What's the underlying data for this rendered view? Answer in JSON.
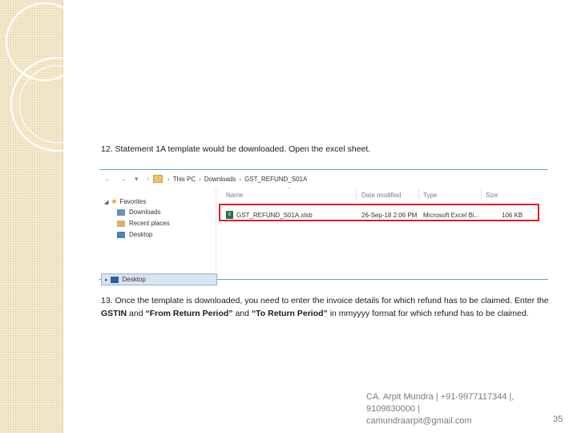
{
  "steps": {
    "step12": "12. Statement 1A template would be downloaded. Open the excel sheet.",
    "step13_part1": "13. Once the template is downloaded, you need to enter the invoice details for which refund has to be claimed. Enter the",
    "step13_gstin": "GSTIN",
    "step13_and": " and ",
    "step13_from": "“From Return Period”",
    "step13_and2": " and ",
    "step13_to": "“To Return Period”",
    "step13_rest": " in mmyyyy format for which refund has to be claimed."
  },
  "explorer": {
    "breadcrumb": [
      "This PC",
      "Downloads",
      "GST_REFUND_S01A"
    ],
    "nav_items": {
      "favorites": "Favorites",
      "downloads": "Downloads",
      "recent_places": "Recent places",
      "desktop_fav": "Desktop",
      "desktop_tree": "Desktop"
    },
    "columns": {
      "name": "Name",
      "date_modified": "Date modified",
      "type": "Type",
      "size": "Size"
    },
    "file": {
      "name": "GST_REFUND_S01A.xlsb",
      "date_modified": "26-Sep-18 2:06 PM",
      "type": "Microsoft Excel Bi...",
      "size": "106 KB"
    }
  },
  "footer": {
    "contact_line1": "CA. Arpit Mundra | +91-9977117344 |,",
    "contact_line2": "9109830000 |",
    "contact_line3": "camundraarpit@gmail.com",
    "page_number": "35"
  },
  "colors": {
    "highlight_border": "#e02020",
    "strip_background": "#f6ecd2",
    "divider_teal": "#55a9b8"
  }
}
